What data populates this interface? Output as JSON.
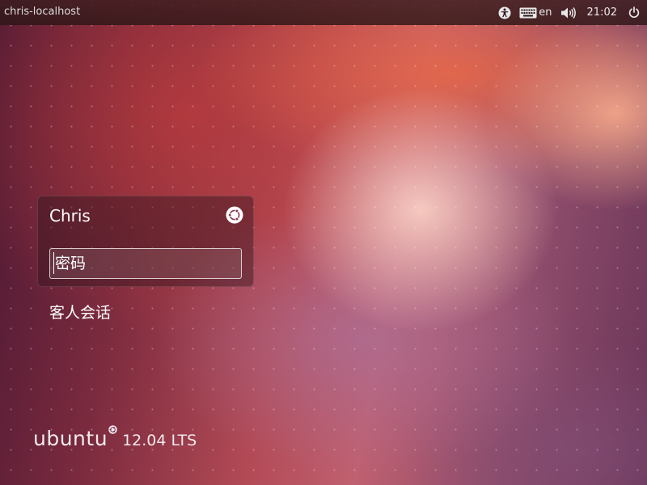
{
  "panel": {
    "hostname": "chris-localhost",
    "language": "en",
    "clock": "21:02",
    "icons": [
      "accessibility-icon",
      "keyboard-icon",
      "volume-icon",
      "power-icon"
    ]
  },
  "greeter": {
    "user_name": "Chris",
    "password_placeholder": "密码",
    "password_value": "",
    "guest_session_label": "客人会话",
    "session_icon": "ubuntu-session-icon"
  },
  "branding": {
    "logo_text": "ubuntu",
    "version": "12.04 LTS"
  },
  "colors": {
    "text": "#ffffff",
    "panel_background": "#2c1616"
  }
}
